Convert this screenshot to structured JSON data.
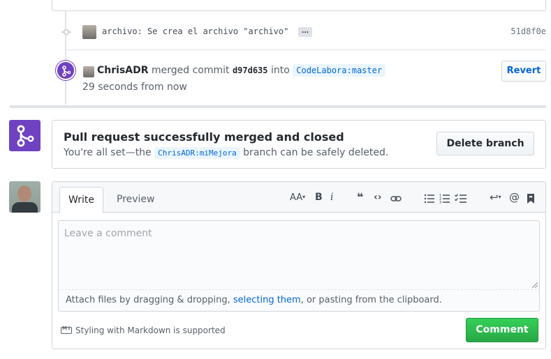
{
  "commit": {
    "message": "archivo: Se crea el archivo \"archivo\"",
    "ellipsis": "…",
    "sha": "51d8f0e"
  },
  "merge_event": {
    "user": "ChrisADR",
    "verb": "merged commit",
    "sha": "d97d635",
    "into": "into",
    "target_branch": "CodeLabora:master",
    "time": "29 seconds from now",
    "revert_label": "Revert"
  },
  "merged_box": {
    "title": "Pull request successfully merged and closed",
    "desc_prefix": "You're all set—the",
    "branch": "ChrisADR:miMejora",
    "desc_suffix": "branch can be safely deleted.",
    "delete_label": "Delete branch"
  },
  "composer": {
    "tabs": {
      "write": "Write",
      "preview": "Preview"
    },
    "toolbar": {
      "heading": "AA",
      "bold": "B",
      "italic": "i"
    },
    "placeholder": "Leave a comment",
    "attach_prefix": "Attach files by dragging & dropping,",
    "attach_link": "selecting them",
    "attach_suffix": ", or pasting from the clipboard.",
    "markdown_note": "Styling with Markdown is supported",
    "comment_label": "Comment"
  },
  "colors": {
    "merged": "#6f42c1",
    "link": "#0366d6",
    "primary_button": "#28a745"
  }
}
